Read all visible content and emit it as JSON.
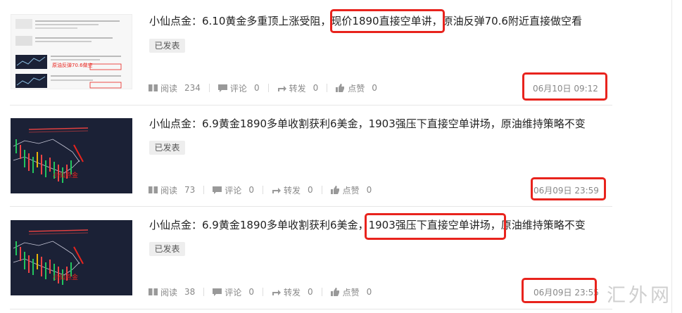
{
  "articles": [
    {
      "title": "小仙点金：6.10黄金多重顶上涨受阻，现价1890直接空单讲，原油反弹70.6附近直接做空看",
      "status": "已发表",
      "reads_label": "阅读",
      "reads": "234",
      "comments_label": "评论",
      "comments": "0",
      "shares_label": "转发",
      "shares": "0",
      "likes_label": "点赞",
      "likes": "0",
      "date": "06月10日 09:12",
      "thumb_style": "light"
    },
    {
      "title": "小仙点金：6.9黄金1890多单收割获利6美金，1903强压下直接空单讲场，原油维持策略不变",
      "status": "已发表",
      "reads_label": "阅读",
      "reads": "73",
      "comments_label": "评论",
      "comments": "0",
      "shares_label": "转发",
      "shares": "0",
      "likes_label": "点赞",
      "likes": "0",
      "date": "06月09日 23:59",
      "thumb_style": "dark"
    },
    {
      "title": "小仙点金：6.9黄金1890多单收割获利6美金，1903强压下直接空单讲场，原油维持策略不变",
      "status": "已发表",
      "reads_label": "阅读",
      "reads": "38",
      "comments_label": "评论",
      "comments": "0",
      "shares_label": "转发",
      "shares": "0",
      "likes_label": "点赞",
      "likes": "0",
      "date": "06月09日 23:55",
      "thumb_style": "dark"
    }
  ],
  "thumb_caption": "小仙点金",
  "watermark": "汇外网",
  "colors": {
    "highlight_box": "#e8231d",
    "badge_bg": "#eeeeee",
    "thumb_dark": "#1b2136"
  }
}
